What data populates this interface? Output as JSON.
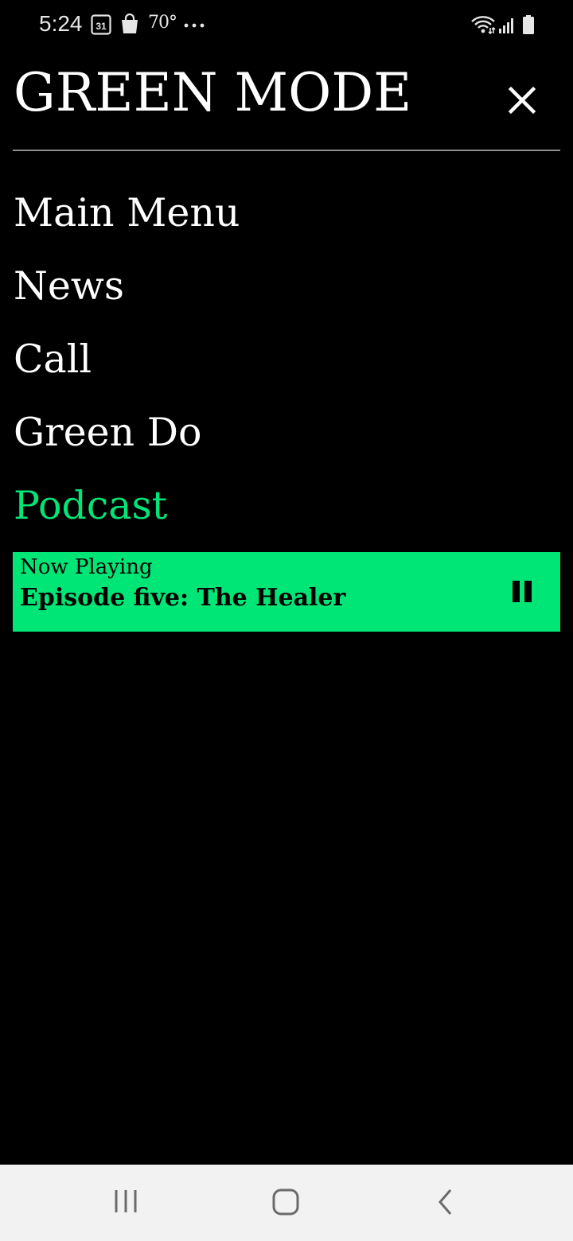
{
  "status_bar": {
    "time": "5:24",
    "calendar_day": "31",
    "temperature": "70°",
    "icons": [
      "calendar-icon",
      "shopping-bag-icon",
      "more-icon",
      "wifi-icon",
      "signal-icon",
      "battery-icon"
    ]
  },
  "header": {
    "title": "GREEN MODE",
    "close_icon": "close-icon"
  },
  "menu": {
    "items": [
      {
        "label": "Main Menu",
        "active": false
      },
      {
        "label": "News",
        "active": false
      },
      {
        "label": "Call",
        "active": false
      },
      {
        "label": "Green Do",
        "active": false
      },
      {
        "label": "Podcast",
        "active": true
      }
    ]
  },
  "now_playing": {
    "label": "Now Playing",
    "title": "Episode five: The Healer",
    "control_icon": "pause-icon"
  },
  "nav_bar": {
    "icons": [
      "recent-apps-icon",
      "home-icon",
      "back-icon"
    ]
  },
  "colors": {
    "background": "#000000",
    "accent": "#00e676",
    "text": "#ffffff",
    "divider": "#8f8f8f",
    "nav_background": "#f2f2f2"
  }
}
